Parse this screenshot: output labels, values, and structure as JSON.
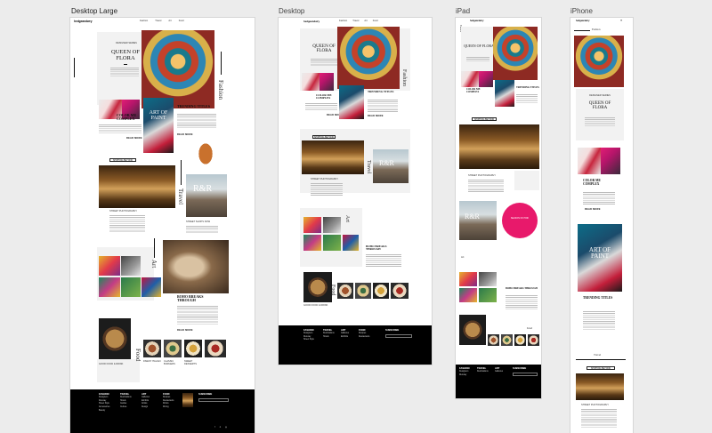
{
  "labels": {
    "desktop_large": "Desktop Large",
    "desktop": "Desktop",
    "ipad": "iPad",
    "iphone": "iPhone"
  },
  "site": {
    "logo": "hedgeandwry",
    "nav": [
      "Fashion",
      "Travel",
      "Art",
      "Food"
    ],
    "hero_kicker": "DESIGNER SERIES",
    "hero_title": "QUEEN OF FLORA",
    "fashion_label": "Fashion",
    "travel_label": "Travel",
    "art_label": "Art",
    "food_label": "Food",
    "color_title": "COLOR ME COMPLEX",
    "art_title": "ART OF PAINT",
    "trending_title": "TRENDING TITLES",
    "travel_button": "SHIPPING BEYOND",
    "rr_title": "R&R",
    "rr_caption": "STREET SHOPS NOW",
    "street_caption": "STREET PHOTOGRAPHY",
    "boho_title": "BOHO BREAKS THROUGH",
    "pink_circle_text": "SEASON OF PINK",
    "read_more": "READ MORE",
    "food_captions": [
      "GOOD FOOD & DRINK",
      "FINEST ITALIAN",
      "CLASSIC BURGERS",
      "SWEET DESSERTS"
    ],
    "footer_cols": [
      {
        "title": "FASHION",
        "items": [
          "Designers",
          "Runway",
          "Street Style",
          "Accessories",
          "Beauty"
        ]
      },
      {
        "title": "TRAVEL",
        "items": [
          "Destinations",
          "Hotels",
          "Guides",
          "Culture"
        ]
      },
      {
        "title": "ART",
        "items": [
          "Galleries",
          "Exhibits",
          "Artists",
          "Design"
        ]
      },
      {
        "title": "FOOD",
        "items": [
          "Recipes",
          "Restaurants",
          "Drinks",
          "Dining"
        ]
      }
    ],
    "subscribe_label": "SUBSCRIBE"
  }
}
